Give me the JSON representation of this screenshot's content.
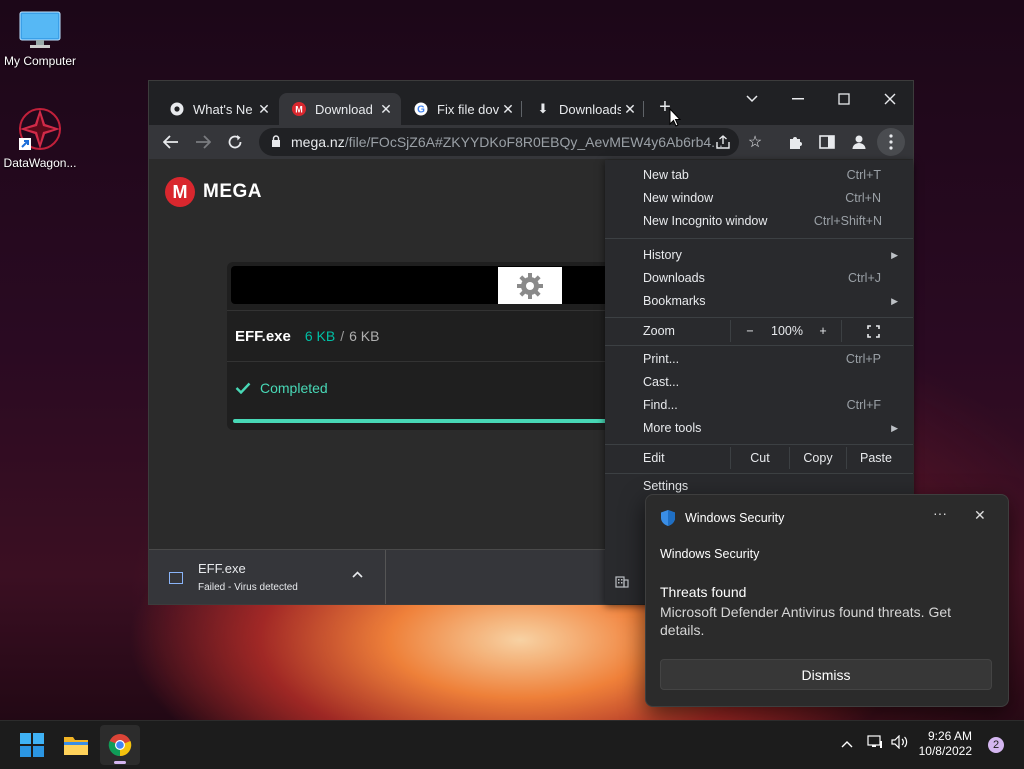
{
  "desktop": {
    "icons": [
      {
        "label": "My Computer",
        "icon": "monitor-icon"
      },
      {
        "label": "DataWagon...",
        "icon": "datawagon-shortcut-icon"
      }
    ]
  },
  "browser": {
    "tabs": [
      {
        "title": "What's Ne",
        "favicon": "chrome-icon",
        "active": false
      },
      {
        "title": "Download",
        "favicon": "mega-icon",
        "active": true
      },
      {
        "title": "Fix file dov",
        "favicon": "google-icon",
        "active": false
      },
      {
        "title": "Downloads",
        "favicon": "download-icon",
        "active": false
      }
    ],
    "new_tab_label": "+",
    "url_host": "mega.nz",
    "url_path": "/file/FOcSjZ6A#ZKYYDKoF8R0EBQy_AevMEW4y6Ab6rb4...",
    "page": {
      "logo_letter": "M",
      "logo_text": "MEGA",
      "file_name": "EFF.exe",
      "downloaded_size": "6 KB",
      "separator": "/",
      "total_size": "6 KB",
      "status": "Completed",
      "progress": 1.0
    },
    "download_bar": {
      "file_name": "EFF.exe",
      "status": "Failed - Virus detected"
    }
  },
  "menu": {
    "items_group1": [
      {
        "label": "New tab",
        "shortcut": "Ctrl+T"
      },
      {
        "label": "New window",
        "shortcut": "Ctrl+N"
      },
      {
        "label": "New Incognito window",
        "shortcut": "Ctrl+Shift+N"
      }
    ],
    "items_group2": [
      {
        "label": "History",
        "shortcut": ""
      },
      {
        "label": "Downloads",
        "shortcut": "Ctrl+J"
      },
      {
        "label": "Bookmarks",
        "shortcut": ""
      }
    ],
    "zoom": {
      "label": "Zoom",
      "minus": "−",
      "value": "100%",
      "plus": "+"
    },
    "items_group3": [
      {
        "label": "Print...",
        "shortcut": "Ctrl+P"
      },
      {
        "label": "Cast...",
        "shortcut": ""
      },
      {
        "label": "Find...",
        "shortcut": "Ctrl+F"
      },
      {
        "label": "More tools",
        "shortcut": ""
      }
    ],
    "edit": {
      "label": "Edit",
      "cut": "Cut",
      "copy": "Copy",
      "paste": "Paste"
    },
    "settings_label": "Settings"
  },
  "toast": {
    "app_name": "Windows Security",
    "app_line": "Windows Security",
    "title": "Threats found",
    "body": "Microsoft Defender Antivirus found threats. Get details.",
    "dismiss_label": "Dismiss",
    "more_label": "···",
    "close_label": "✕"
  },
  "taskbar": {
    "time": "9:26 AM",
    "date": "10/8/2022",
    "notification_count": "2"
  }
}
